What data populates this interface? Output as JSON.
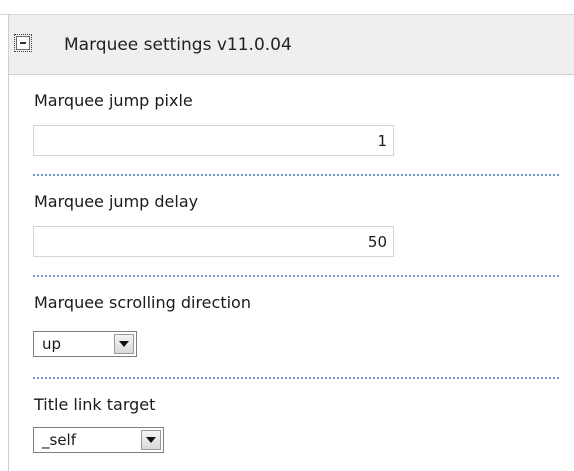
{
  "header": {
    "title": "Marquee settings v11.0.04",
    "collapse_icon": "minus-box-icon"
  },
  "fields": {
    "jump_pixle": {
      "label": "Marquee jump pixle",
      "value": "1"
    },
    "jump_delay": {
      "label": "Marquee jump delay",
      "value": "50"
    },
    "scrolling_direction": {
      "label": "Marquee scrolling direction",
      "selected": "up"
    },
    "title_link_target": {
      "label": "Title link target",
      "selected": "_self"
    }
  },
  "colors": {
    "separator": "#6f9bd0",
    "header_bg": "#efefef"
  }
}
